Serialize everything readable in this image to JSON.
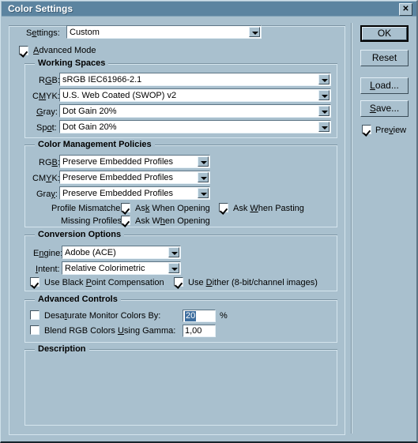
{
  "window": {
    "title": "Color Settings",
    "close_label": "✕"
  },
  "settings_row": {
    "label": "Settings:",
    "mnemonic": "e",
    "value": "Custom"
  },
  "advanced_mode": {
    "label": "Advanced Mode",
    "mnemonic": "A",
    "checked": true
  },
  "working_spaces": {
    "title": "Working Spaces",
    "rows": [
      {
        "label": "RGB:",
        "mnemonic": "G",
        "value": "sRGB IEC61966-2.1"
      },
      {
        "label": "CMYK:",
        "mnemonic": "M",
        "value": "U.S. Web Coated (SWOP) v2"
      },
      {
        "label": "Gray:",
        "mnemonic": "G",
        "value": "Dot Gain 20%"
      },
      {
        "label": "Spot:",
        "mnemonic": "o",
        "value": "Dot Gain 20%"
      }
    ]
  },
  "color_management_policies": {
    "title": "Color Management Policies",
    "rows": [
      {
        "label": "RGB:",
        "mnemonic": "B",
        "value": "Preserve Embedded Profiles"
      },
      {
        "label": "CMYK:",
        "mnemonic": "Y",
        "value": "Preserve Embedded Profiles"
      },
      {
        "label": "Gray:",
        "mnemonic": "y",
        "value": "Preserve Embedded Profiles"
      }
    ],
    "profile_mismatches_label": "Profile Mismatches:",
    "missing_profiles_label": "Missing Profiles:",
    "ask_when_opening_1": "Ask When Opening",
    "ask_when_opening_1_mnemonic": "k",
    "ask_when_pasting": "Ask When Pasting",
    "ask_when_pasting_mnemonic": "W",
    "ask_when_opening_2": "Ask When Opening",
    "ask_when_opening_2_mnemonic": "h",
    "mismatch_open_checked": true,
    "mismatch_paste_checked": true,
    "missing_open_checked": true
  },
  "conversion_options": {
    "title": "Conversion Options",
    "engine_label": "Engine:",
    "engine_mnemonic": "n",
    "engine_value": "Adobe (ACE)",
    "intent_label": "Intent:",
    "intent_mnemonic": "I",
    "intent_value": "Relative Colorimetric",
    "black_point_label": "Use Black Point Compensation",
    "black_point_mnemonic": "P",
    "black_point_checked": true,
    "dither_label": "Use Dither (8-bit/channel images)",
    "dither_mnemonic": "D",
    "dither_checked": true
  },
  "advanced_controls": {
    "title": "Advanced Controls",
    "desaturate_label": "Desaturate Monitor Colors By:",
    "desaturate_mnemonic": "t",
    "desaturate_checked": false,
    "desaturate_value": "20",
    "percent_sign": "%",
    "blend_label": "Blend RGB Colors Using Gamma:",
    "blend_mnemonic": "U",
    "blend_checked": false,
    "blend_value": "1,00"
  },
  "description": {
    "title": "Description",
    "text": ""
  },
  "buttons": {
    "ok": "OK",
    "reset": "Reset",
    "load": "Load...",
    "load_mnemonic": "L",
    "save": "Save...",
    "save_mnemonic": "S",
    "preview_label": "Preview",
    "preview_mnemonic": "v",
    "preview_checked": true
  },
  "colors": {
    "dialog_bg": "#a9c0ce",
    "titlebar": "#5c84a0",
    "title_text": "#ffffff",
    "field_bg": "#ffffff",
    "selection": "#3d6d9e",
    "frame_dark": "#7b93a2",
    "frame_light": "#d5e5ee"
  }
}
